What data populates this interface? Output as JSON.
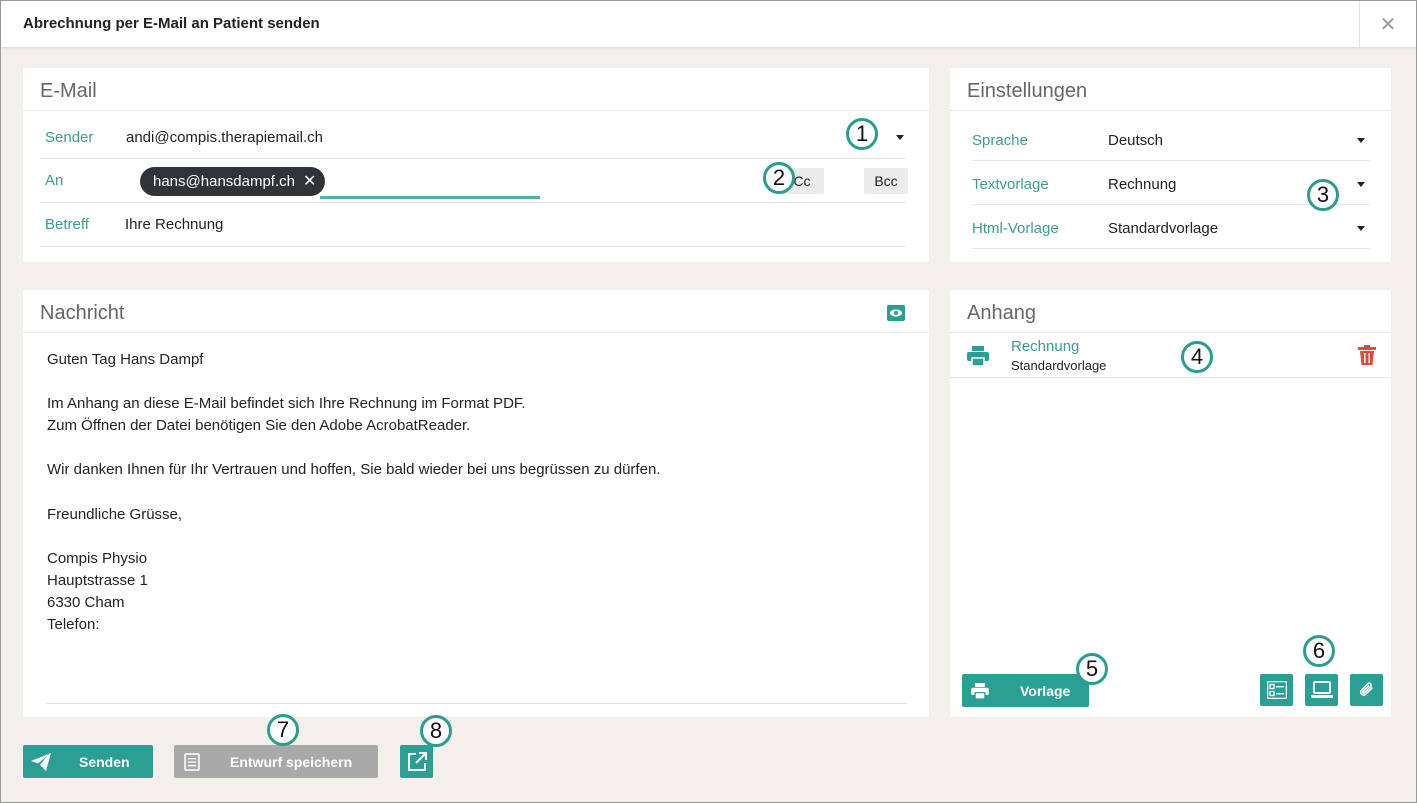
{
  "dialog": {
    "title": "Abrechnung per E-Mail an Patient senden",
    "close_symbol": "✕"
  },
  "email": {
    "header": "E-Mail",
    "sender_label": "Sender",
    "sender_value": "andi@compis.therapiemail.ch",
    "to_label": "An",
    "recipient_chip": "hans@hansdampf.ch",
    "cc_label": "Cc",
    "bcc_label": "Bcc",
    "subject_label": "Betreff",
    "subject_value": "Ihre Rechnung"
  },
  "settings": {
    "header": "Einstellungen",
    "language_label": "Sprache",
    "language_value": "Deutsch",
    "text_template_label": "Textvorlage",
    "text_template_value": "Rechnung",
    "html_template_label": "Html-Vorlage",
    "html_template_value": "Standardvorlage"
  },
  "message": {
    "header": "Nachricht",
    "lines": [
      "Guten Tag Hans Dampf",
      "",
      "Im Anhang an diese E-Mail befindet sich Ihre Rechnung im Format PDF.",
      "Zum Öffnen der Datei benötigen Sie den Adobe AcrobatReader.",
      "",
      "Wir danken Ihnen für Ihr Vertrauen und hoffen, Sie bald wieder bei uns begrüssen zu dürfen.",
      "",
      "Freundliche Grüsse,",
      "",
      "Compis Physio",
      "Hauptstrasse 1",
      "6330 Cham",
      "Telefon:"
    ]
  },
  "attachments": {
    "header": "Anhang",
    "items": [
      {
        "name": "Rechnung",
        "template": "Standardvorlage"
      }
    ],
    "template_button_label": "Vorlage"
  },
  "footer": {
    "send_label": "Senden",
    "save_draft_label": "Entwurf speichern"
  },
  "callouts": [
    "1",
    "2",
    "3",
    "4",
    "5",
    "6",
    "7",
    "8"
  ],
  "colors": {
    "accent": "#2aa094",
    "delete": "#e0493b",
    "chip": "#2f3439",
    "label": "#3a9d94"
  },
  "icons": [
    "close-icon",
    "caret-down-icon",
    "chip-remove-icon",
    "eye-icon",
    "printer-icon",
    "trash-icon",
    "list-icon",
    "laptop-icon",
    "paperclip-icon",
    "paper-plane-icon",
    "document-icon",
    "external-link-icon"
  ]
}
